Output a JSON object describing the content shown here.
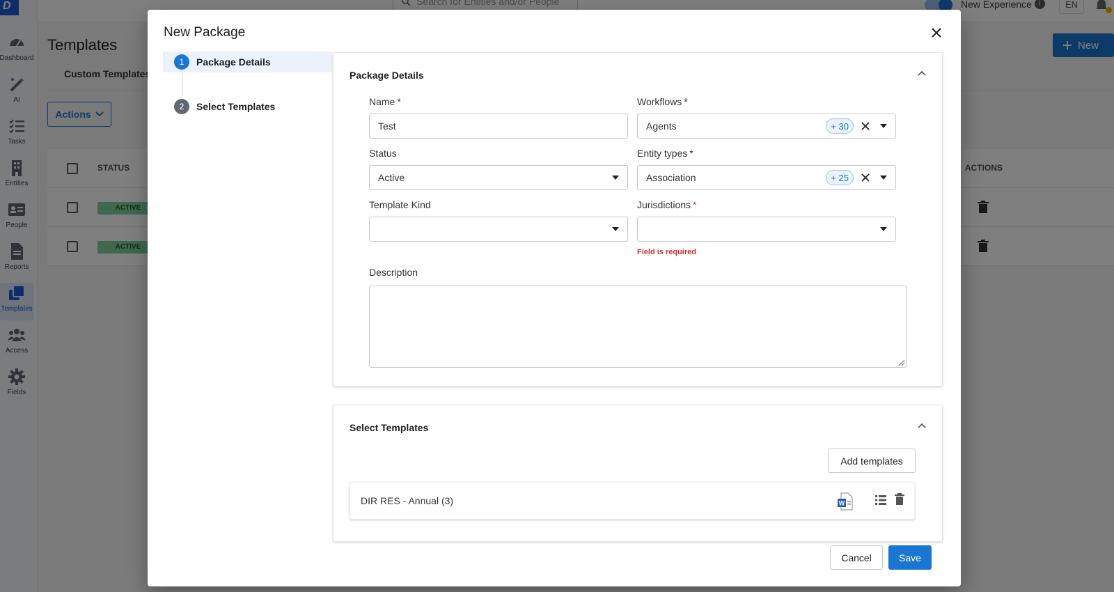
{
  "app": {
    "sidebar": {
      "items": [
        {
          "label": "Dashboard",
          "icon": "speedometer-icon"
        },
        {
          "label": "AI",
          "icon": "magic-wand-icon"
        },
        {
          "label": "Tasks",
          "icon": "checklist-icon"
        },
        {
          "label": "Entities",
          "icon": "building-icon"
        },
        {
          "label": "People",
          "icon": "id-card-icon"
        },
        {
          "label": "Reports",
          "icon": "document-icon"
        },
        {
          "label": "Templates",
          "icon": "copy-icon"
        },
        {
          "label": "Access",
          "icon": "users-icon"
        },
        {
          "label": "Fields",
          "icon": "gear-icon"
        }
      ]
    },
    "topbar": {
      "search_placeholder": "Search for Entities and/or People",
      "experience_label": "New Experience",
      "language": "EN"
    },
    "page_title": "Templates",
    "new_button": "New",
    "tab": "Custom Templates",
    "actions_button": "Actions",
    "table": {
      "status_header": "STATUS",
      "actions_header": "ACTIONS",
      "rows": [
        {
          "status": "ACTIVE"
        },
        {
          "status": "ACTIVE"
        }
      ]
    }
  },
  "dialog": {
    "title": "New Package",
    "steps": [
      {
        "number": "1",
        "label": "Package Details"
      },
      {
        "number": "2",
        "label": "Select Templates"
      }
    ],
    "details": {
      "title": "Package Details",
      "name": {
        "label": "Name",
        "required": "*",
        "value": "Test"
      },
      "workflows": {
        "label": "Workflows",
        "required": "*",
        "value": "Agents",
        "more": "+ 30"
      },
      "status": {
        "label": "Status",
        "value": "Active"
      },
      "entity_types": {
        "label": "Entity types",
        "required": "*",
        "value": "Association",
        "more": "+ 25"
      },
      "template_kind": {
        "label": "Template Kind",
        "value": ""
      },
      "jurisdictions": {
        "label": "Jurisdictions",
        "required": "*",
        "value": "",
        "error": "Field is required"
      },
      "description": {
        "label": "Description",
        "value": ""
      }
    },
    "templates": {
      "title": "Select Templates",
      "add_button": "Add templates",
      "items": [
        {
          "name": "DIR RES - Annual (3)",
          "icon": "word-doc-icon"
        }
      ]
    },
    "cancel_button": "Cancel",
    "save_button": "Save"
  },
  "colors": {
    "primary": "#1976d2",
    "error": "#d32f2f",
    "active_badge": "#7ed09a"
  }
}
